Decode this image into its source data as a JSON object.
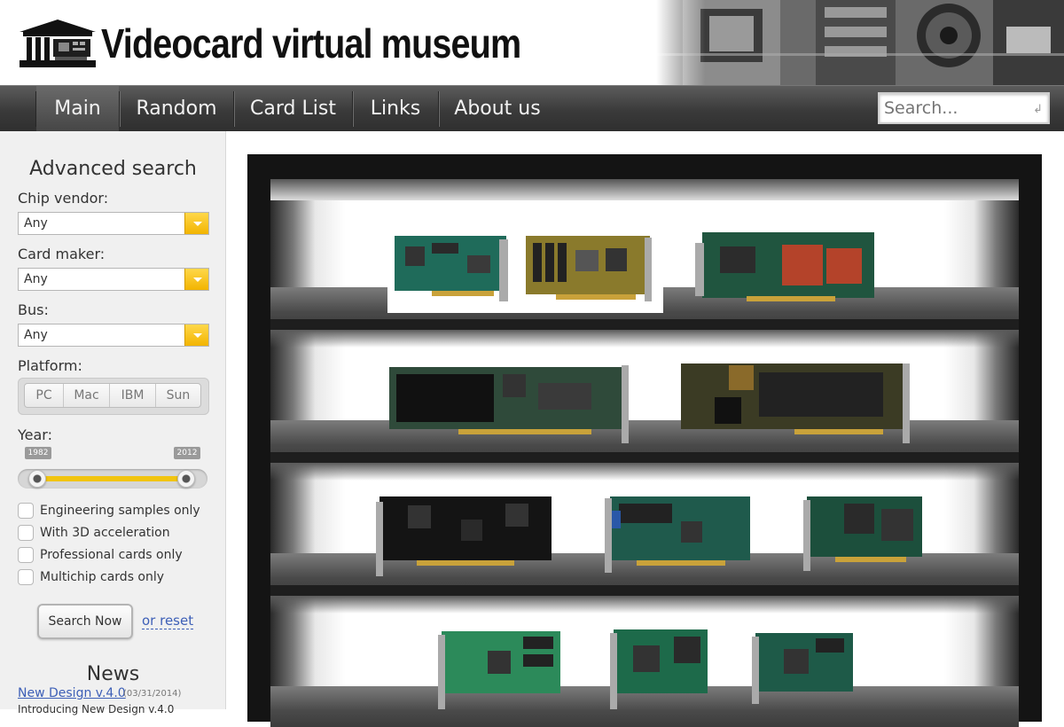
{
  "site": {
    "title": "Videocard virtual museum"
  },
  "nav": {
    "items": [
      {
        "label": "Main",
        "active": true
      },
      {
        "label": "Random"
      },
      {
        "label": "Card List"
      },
      {
        "label": "Links"
      },
      {
        "label": "About us"
      }
    ],
    "search_placeholder": "Search...",
    "search_enter_icon": "enter-icon"
  },
  "sidebar": {
    "title": "Advanced search",
    "filters": {
      "chip_vendor": {
        "label": "Chip vendor:",
        "value": "Any"
      },
      "card_maker": {
        "label": "Card maker:",
        "value": "Any"
      },
      "bus": {
        "label": "Bus:",
        "value": "Any"
      }
    },
    "platform": {
      "label": "Platform:",
      "options": [
        "PC",
        "Mac",
        "IBM",
        "Sun"
      ]
    },
    "year": {
      "label": "Year:",
      "min": "1982",
      "max": "2012"
    },
    "checkboxes": [
      "Engineering samples only",
      "With 3D acceleration",
      "Professional cards only",
      "Multichip cards only"
    ],
    "search_button": "Search Now",
    "reset_link": "or reset"
  },
  "news": {
    "title": "News",
    "items": [
      {
        "link": "New Design v.4.0",
        "date": "(03/31/2014)",
        "intro": "Introducing New Design v.4.0"
      }
    ]
  },
  "colors": {
    "nav_bg": "#3a3a3a",
    "accent_yellow": "#f2b400",
    "link_blue": "#3d5fb7",
    "sidebar_bg": "#f0f0f0"
  }
}
